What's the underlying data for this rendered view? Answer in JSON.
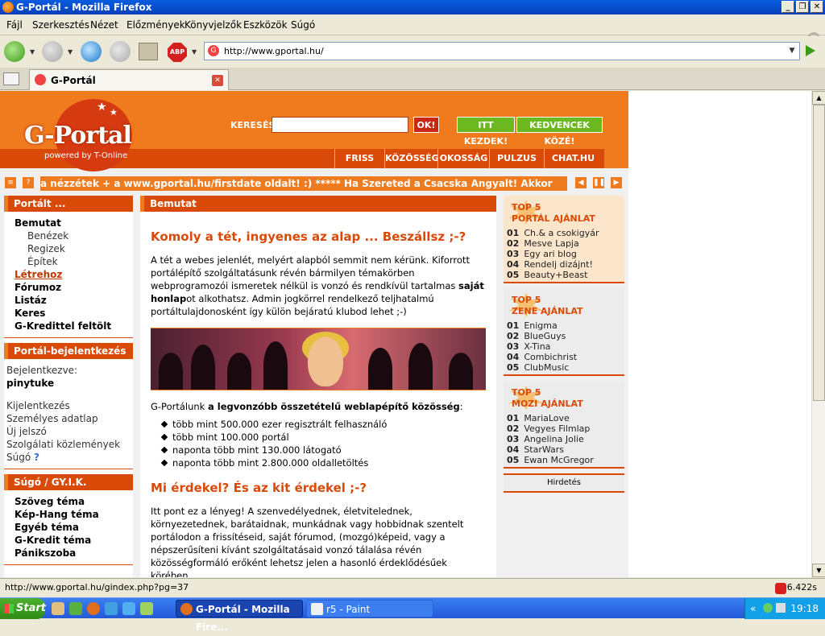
{
  "window": {
    "title": "G-Portál - Mozilla Firefox",
    "buttons": [
      "_",
      "❐",
      "✕"
    ]
  },
  "menu": [
    "Fájl",
    "Szerkesztés",
    "Nézet",
    "Előzmények",
    "Könyvjelzők",
    "Eszközök",
    "Súgó"
  ],
  "nav": {
    "abp_label": "ABP",
    "url": "http://www.gportal.hu/"
  },
  "tab": {
    "title": "G-Portál"
  },
  "header": {
    "logo_text": "G-Portal",
    "logo_sub": "powered by T-Online",
    "search_label": "KERESÉS",
    "ok_label": "OK!",
    "start_label": "ITT KEZDEK!",
    "fav_label": "KEDVENCEK KÖZÉ!",
    "nav_links": [
      "FRISS",
      "KÖZÖSSÉG",
      "OKOSSÁG",
      "PULZUS",
      "CHAT.HU"
    ]
  },
  "ticker": {
    "text": "a nézzétek + a www.gportal.hu/firstdate oldalt! :)   *****   Ha Szereted a Csacska Angyalt! Akkor"
  },
  "left": {
    "portal_head": "Portált ...",
    "portal_items": [
      {
        "label": "Bemutat",
        "sub": false
      },
      {
        "label": "Benézek",
        "sub": true
      },
      {
        "label": "Regizek",
        "sub": true
      },
      {
        "label": "Építek",
        "sub": true
      },
      {
        "label": "Létrehoz",
        "sub": false,
        "active": true
      },
      {
        "label": "Fórumoz",
        "sub": false
      },
      {
        "label": "Listáz",
        "sub": false
      },
      {
        "label": "Keres",
        "sub": false
      },
      {
        "label": "G-Kredittel feltölt",
        "sub": false
      }
    ],
    "login_head": "Portál-bejelentkezés",
    "login_label": "Bejelentkezve:",
    "login_user": "pinytuke",
    "login_links": [
      "Kijelentkezés",
      "Személyes adatlap",
      "Új jelszó",
      "Szolgálati közlemények",
      "Súgó"
    ],
    "help_icon": "?",
    "help_head": "Súgó / GY.I.K.",
    "help_items": [
      "Szöveg téma",
      "Kép-Hang téma",
      "Egyéb téma",
      "G-Kredit téma",
      "Pánikszoba"
    ]
  },
  "main": {
    "head": "Bemutat",
    "title1": "Komoly a tét, ingyenes az alap ... Beszállsz ;-?",
    "para1_a": "A tét a webes jelenlét, melyért alapból semmit nem kérünk. Kiforrott portálépítő szolgáltatásunk révén bármilyen témakörben webprogramozói ismeretek nélkül is vonzó és rendkívül tartalmas ",
    "para1_b": "saját honlap",
    "para1_c": "ot alkothatsz. Admin jogkörrel rendelkező teljhatalmú portáltulajdonosként így külön bejáratú klubod lehet ;-)",
    "para2_a": "G-Portálunk ",
    "para2_b": "a legvonzóbb összetételű weblapépítő közösség",
    "para2_c": ":",
    "stats": [
      "több mint 500.000 ezer regisztrált felhasználó",
      "több mint 100.000 portál",
      "naponta több mint 130.000 látogató",
      "naponta több mint 2.800.000 oldalletöltés"
    ],
    "title2": "Mi érdekel? És az kit érdekel ;-?",
    "para3": "Itt pont ez a lényeg! A szenvedélyednek, életvitelednek, környezetednek, barátaidnak, munkádnak vagy hobbidnak szentelt portálodon a frissítéseid, saját fórumod, (mozgó)képeid, vagy a népszerűsíteni kívánt szolgáltatásaid vonzó tálalása révén közösségformáló erőként lehetsz jelen a hasonló érdeklődésűek körében..."
  },
  "right": {
    "boxes": [
      {
        "top": "TOP 5",
        "name": "PORTÁL AJÁNLAT",
        "items": [
          "Ch.& a csokigyár",
          "Mesve Lapja",
          "Egy ari blog",
          "Rendelj dizájnt!",
          "Beauty+Beast"
        ]
      },
      {
        "top": "TOP 5",
        "name": "ZENE AJÁNLAT",
        "items": [
          "Enigma",
          "BlueGuys",
          "X-Tina",
          "Combichrist",
          "ClubMusic"
        ]
      },
      {
        "top": "TOP 5",
        "name": "MOZI AJÁNLAT",
        "items": [
          "MariaLove",
          "Vegyes Filmlap",
          "Angelina Jolie",
          "StarWars",
          "Ewan McGregor"
        ]
      }
    ],
    "nums": [
      "01",
      "02",
      "03",
      "04",
      "05"
    ],
    "ad_label": "Hirdetés"
  },
  "status": {
    "url": "http://www.gportal.hu/gindex.php?pg=37",
    "time": "6.422s"
  },
  "taskbar": {
    "start": "Start",
    "items": [
      "G-Portál - Mozilla Fire...",
      "r5 - Paint"
    ],
    "chevron": "«",
    "clock": "19:18"
  }
}
